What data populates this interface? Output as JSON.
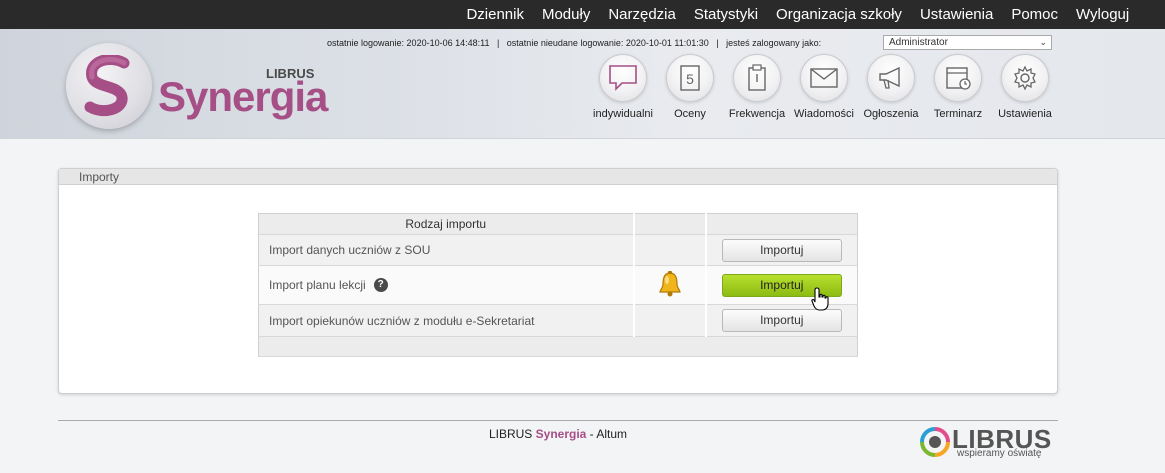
{
  "topnav": {
    "items": [
      "Dziennik",
      "Moduły",
      "Narzędzia",
      "Statystyki",
      "Organizacja szkoły",
      "Ustawienia",
      "Pomoc"
    ],
    "logout": "Wyloguj"
  },
  "header": {
    "logo_librus": "LIBRUS",
    "logo_word": "Synergia",
    "login_info": "ostatnie logowanie: 2020-10-06 14:48:11   |   ostatnie nieudane logowanie: 2020-10-01 11:01:30   |   jesteś zalogowany jako:",
    "role_select": "Administrator",
    "icons": [
      {
        "label": "indywidualni",
        "icon": "speech-bubble-icon"
      },
      {
        "label": "Oceny",
        "icon": "grade-5-icon"
      },
      {
        "label": "Frekwencja",
        "icon": "clipboard-icon"
      },
      {
        "label": "Wiadomości",
        "icon": "envelope-icon"
      },
      {
        "label": "Ogłoszenia",
        "icon": "megaphone-icon"
      },
      {
        "label": "Terminarz",
        "icon": "calendar-icon"
      },
      {
        "label": "Ustawienia",
        "icon": "gear-icon"
      }
    ]
  },
  "panel": {
    "title": "Importy",
    "table": {
      "header": "Rodzaj importu",
      "rows": [
        {
          "name": "Import danych uczniów z SOU",
          "button": "Importuj"
        },
        {
          "name": "Import planu lekcji",
          "button": "Importuj"
        },
        {
          "name": "Import opiekunów uczniów z modułu e-Sekretariat",
          "button": "Importuj"
        }
      ]
    }
  },
  "footer": {
    "text_prefix": "LIBRUS ",
    "text_brand": "Synergia",
    "text_suffix": " - Altum",
    "logo_word": "LIBRUS",
    "logo_tagline": "wspieramy oświatę"
  },
  "colors": {
    "brand": "#a64f86",
    "active_button": "#9ccb1f",
    "topbar": "#2a2a2a"
  }
}
